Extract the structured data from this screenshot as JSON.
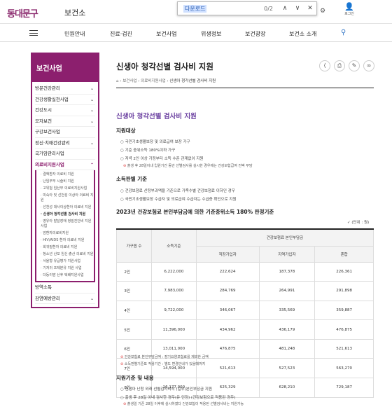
{
  "header": {
    "logo": "동대문구",
    "title": "보건소",
    "login": "로그인"
  },
  "find": {
    "query": "다운로드",
    "count": "0/2",
    "up": "∧",
    "down": "∨",
    "close": "✕"
  },
  "nav": [
    "민원안내",
    "진료·검진",
    "보건사업",
    "위생정보",
    "보건광장",
    "보건소 소개"
  ],
  "sidebar": {
    "title": "보건사업",
    "items": [
      {
        "label": "방문건강관리"
      },
      {
        "label": "건강생활실천사업"
      },
      {
        "label": "건강도시"
      },
      {
        "label": "모자보건"
      },
      {
        "label": "구강보건사업"
      },
      {
        "label": "정신·치매건강관리"
      },
      {
        "label": "국가암관리사업"
      },
      {
        "label": "의료비지원사업"
      }
    ],
    "sub": [
      "결핵환자 의료비 지원",
      "난임부부 시술비 지원",
      "고위험 임산부 의료비지원사업",
      "미숙아 및 선천성 이상아 의료비 지원",
      "선천성 대사이상환아 의료비 지원",
      "신생아 청각선별 검사비 지원",
      "영유아 발달장애 정밀진단비 지원사업",
      "암환자의료비지원",
      "HIV/AIDS 환자 의료비 지원",
      "희귀질환자 의료비 지원",
      "청소년 산모 임신·출산 의료비 지원",
      "서울형 유급병가 지원사업",
      "기저귀 조제분유 지원 사업",
      "더동이맘 산후 택배지원사업"
    ],
    "after": [
      {
        "label": "방역소독"
      },
      {
        "label": "감염예방관리"
      }
    ]
  },
  "page": {
    "title": "신생아 청각선별 검사비 지원",
    "breadcrumb": [
      "보건사업",
      "의료비지원사업",
      "신생아 청각선별 검사비 지원"
    ]
  },
  "content": {
    "h2": "신생아 청각선별 검사비 지원",
    "target_h": "지원대상",
    "target": [
      "국민기초생활보장 및 의료급여 보장 가구",
      "기준 중위소득 180%이하 가구",
      "저녁 2인 이상 가정부터 소득 수준 관계없이 지원"
    ],
    "target_note": "출생 후 28일이내 입원기간 동안 선별검사를 실시한 경우에는 건강보험급여 전액 부담",
    "criteria_h": "소득판별 기준",
    "criteria": [
      "건강보험료 산정부과액을 기준으로 가족수별 건강보험료 이하인 경우",
      "국민기초생활보장 수급자 및 의료급여 수급자는 수급증 확인으로 지원"
    ],
    "table_h": "2023년 건강보험료 본인부담금에 의한 기준중위소득 180% 판정기준",
    "unit": "(단위 : 원)",
    "cols": {
      "family": "가구원 수",
      "base": "소득기준",
      "group": "건강보험료 본인부담금",
      "work": "직장가입자",
      "local": "지역가입자",
      "mixed": "혼합"
    },
    "rows": [
      [
        "2인",
        "6,222,000",
        "222,624",
        "187,378",
        "226,361"
      ],
      [
        "3인",
        "7,983,000",
        "284,769",
        "264,991",
        "291,898"
      ],
      [
        "4인",
        "9,722,000",
        "346,067",
        "335,569",
        "359,887"
      ],
      [
        "5인",
        "11,396,000",
        "434,962",
        "436,179",
        "476,875"
      ],
      [
        "6인",
        "13,011,000",
        "476,875",
        "481,248",
        "521,613"
      ],
      [
        "7인",
        "14,594,000",
        "521,613",
        "527,523",
        "563,270"
      ],
      [
        "8인",
        "16,177,000",
        "625,329",
        "628,210",
        "729,187"
      ]
    ],
    "notes": [
      "건강보험료 본인부담금액 : 장기요양보험료를 제외한 금액",
      "소득판별기준표 적용기간 : 별도 변경안내가 있을때까지"
    ],
    "support_h": "지원기준 및 내용",
    "support": [
      "신생아 난청 외래 선별검사비의 (일부)본인부담금 지원",
      "출생 후 28일 이내 검사한 경우(유 인정) (건강보험으로 적용된 경우)"
    ],
    "support_note": "출생일 기준 28일 이후에 실시하였다 건강보험이 적용된 선별검사비는 지원가능"
  }
}
